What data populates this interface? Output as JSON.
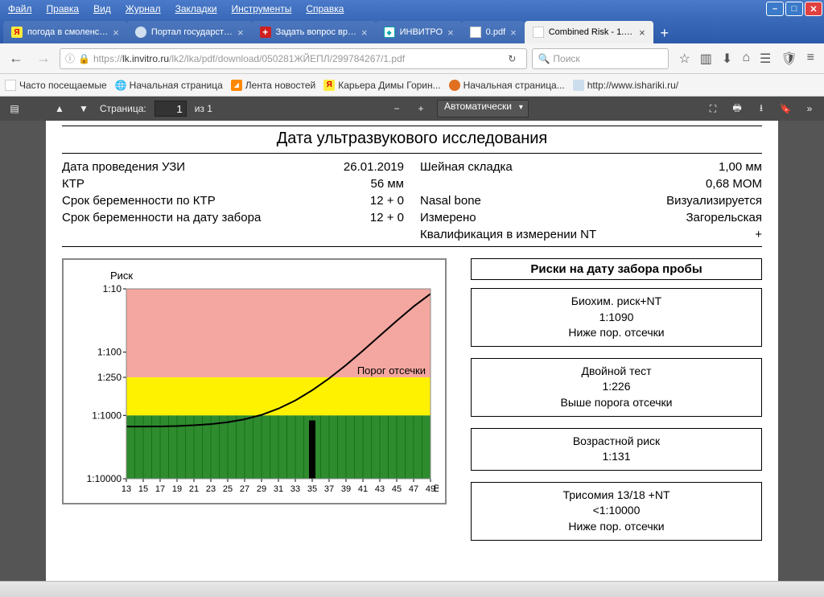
{
  "menu": {
    "file": "Файл",
    "edit": "Правка",
    "view": "Вид",
    "history": "Журнал",
    "bookmarks": "Закладки",
    "tools": "Инструменты",
    "help": "Справка"
  },
  "tabs": [
    {
      "label": "погода в смоленс…"
    },
    {
      "label": "Портал государст…"
    },
    {
      "label": "Задать вопрос вр…"
    },
    {
      "label": "ИНВИТРО"
    },
    {
      "label": "0.pdf"
    },
    {
      "label": "Combined Risk - 1.pdf"
    }
  ],
  "url": {
    "info": "ⓘ",
    "host": "lk.invitro.ru",
    "path": "/lk2/lka/pdf/download/050281ЖЙЕПЛ/299784267/1.pdf",
    "prefix": "https://"
  },
  "search": {
    "placeholder": "Поиск"
  },
  "bookmarks": [
    {
      "label": "Часто посещаемые"
    },
    {
      "label": "Начальная страница"
    },
    {
      "label": "Лента новостей"
    },
    {
      "label": "Карьера Димы Горин..."
    },
    {
      "label": "Начальная страница..."
    },
    {
      "label": "http://www.ishariki.ru/"
    }
  ],
  "pdf": {
    "page_label": "Страница:",
    "page": "1",
    "of": "из 1",
    "zoom": "Автоматически"
  },
  "doc": {
    "title": "Дата ультразвукового исследования",
    "left": [
      {
        "l": "Дата проведения УЗИ",
        "v": "26.01.2019"
      },
      {
        "l": "КТР",
        "v": "56 мм"
      },
      {
        "l": "Срок беременности по КТР",
        "v": "12 +   0"
      },
      {
        "l": "Срок беременности на дату забора",
        "v": "12 +   0"
      }
    ],
    "right": [
      {
        "l": "Шейная складка",
        "v": "1,00   мм"
      },
      {
        "l": "",
        "v": "0,68 MOM"
      },
      {
        "l": "Nasal bone",
        "v": "Визуализируется"
      },
      {
        "l": "Измерено",
        "v": "Загорельская"
      },
      {
        "l": "Квалификация в измерении NT",
        "v": "+"
      }
    ],
    "risks_header": "Риски на дату забора пробы",
    "risk_cards": [
      {
        "l1": "Биохим. риск+NT",
        "l2": "1:1090",
        "l3": "Ниже пор. отсечки"
      },
      {
        "l1": "Двойной тест",
        "l2": "1:226",
        "l3": "Выше порога отсечки"
      },
      {
        "l1": "Возрастной риск",
        "l2": "1:131",
        "l3": ""
      },
      {
        "l1": "Трисомия 13/18 +NT",
        "l2": "<1:10000",
        "l3": "Ниже пор. отсечки"
      }
    ],
    "chart": {
      "ylabel": "Риск",
      "xlabel": "Возр.",
      "threshold": "Порог отсечки"
    }
  },
  "chart_data": {
    "type": "area",
    "title": "Риск",
    "xlabel": "Возр.",
    "ylabel": "Риск",
    "x_ticks": [
      13,
      15,
      17,
      19,
      21,
      23,
      25,
      27,
      29,
      31,
      33,
      35,
      37,
      39,
      41,
      43,
      45,
      47,
      49
    ],
    "y_ticks_labels": [
      "1:10",
      "1:100",
      "1:250",
      "1:1000",
      "1:10000"
    ],
    "y_ticks_values": [
      10,
      100,
      250,
      1000,
      10000
    ],
    "log_scale": true,
    "threshold_label": "Порог отсечки",
    "threshold_value": 250,
    "bands": [
      {
        "from": 10,
        "to": 250,
        "color": "#f4a7a0"
      },
      {
        "from": 250,
        "to": 1000,
        "color": "#fff200"
      },
      {
        "from": 1000,
        "to": 10000,
        "color": "#2e8b2e"
      }
    ],
    "series": [
      {
        "name": "risk-curve",
        "x": [
          13,
          15,
          17,
          19,
          21,
          23,
          25,
          27,
          29,
          31,
          33,
          35,
          37,
          39,
          41,
          43,
          45,
          47,
          49
        ],
        "y": [
          1500,
          1500,
          1490,
          1470,
          1430,
          1370,
          1280,
          1150,
          980,
          780,
          580,
          400,
          260,
          160,
          95,
          55,
          32,
          19,
          12
        ]
      }
    ],
    "marker": {
      "x": 35,
      "ylo": 10000,
      "yhi": 1200
    }
  }
}
